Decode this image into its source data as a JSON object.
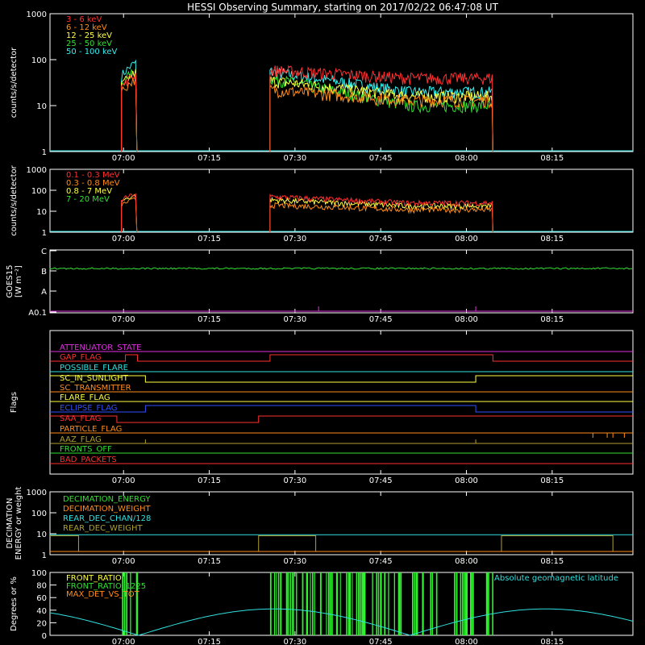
{
  "chart_data": {
    "type": "line",
    "title": "HESSI Observing Summary, starting on 2017/02/22 06:47:08 UT",
    "x_ticks": [
      "07:00",
      "07:15",
      "07:30",
      "07:45",
      "08:00",
      "08:15"
    ],
    "panels": [
      {
        "id": "lightcurve",
        "ylabel": "counts/s/detector",
        "scale": "log",
        "ylim": [
          1,
          1000
        ],
        "yticks": [
          "1",
          "10",
          "100",
          "1000"
        ],
        "series": [
          {
            "name": "3 - 6 keV",
            "color": "#ff3030",
            "pre": 50,
            "start": 60,
            "end": 40
          },
          {
            "name": "6 - 12 keV",
            "color": "#ff8c1a",
            "pre": 40,
            "start": 22,
            "end": 13
          },
          {
            "name": "12 - 25 keV",
            "color": "#ffff40",
            "pre": 55,
            "start": 35,
            "end": 16
          },
          {
            "name": "25 - 50 keV",
            "color": "#30e030",
            "pre": 60,
            "start": 40,
            "end": 10
          },
          {
            "name": "50 - 100 keV",
            "color": "#30f0f0",
            "pre": 90,
            "start": 55,
            "end": 20
          }
        ]
      },
      {
        "id": "gamma",
        "ylabel": "counts/s/detector",
        "scale": "log",
        "ylim": [
          1,
          1000
        ],
        "yticks": [
          "1",
          "10",
          "100",
          "1000"
        ],
        "series": [
          {
            "name": "0.1 - 0.3 MeV",
            "color": "#ff3030",
            "pre": 70,
            "start": 50,
            "end": 25
          },
          {
            "name": "0.3 - 0.8 MeV",
            "color": "#ff8c1a",
            "pre": 40,
            "start": 20,
            "end": 12
          },
          {
            "name": "0.8 - 7 MeV",
            "color": "#ffff40",
            "pre": 60,
            "start": 35,
            "end": 18
          },
          {
            "name": "7 - 20 MeV",
            "color": "#30e030",
            "pre": 1,
            "start": 1,
            "end": 1
          }
        ]
      },
      {
        "id": "goes",
        "ylabel_lines": [
          "GOES15",
          "[W m⁻²]"
        ],
        "yticks": [
          "A0.1",
          "A",
          "B",
          "C"
        ]
      },
      {
        "id": "flags",
        "ylabel": "Flags",
        "flags": [
          {
            "name": "ATTENUATOR_STATE",
            "color": "#e030e0"
          },
          {
            "name": "GAP_FLAG",
            "color": "#ff3030"
          },
          {
            "name": "POSSIBLE_FLARE",
            "color": "#30e0e0"
          },
          {
            "name": "SC_IN_SUNLIGHT",
            "color": "#ffff40"
          },
          {
            "name": "SC_TRANSMITTER",
            "color": "#ff8c1a"
          },
          {
            "name": "FLARE_FLAG",
            "color": "#ffff40"
          },
          {
            "name": "ECLIPSE_FLAG",
            "color": "#3050ff"
          },
          {
            "name": "SAA_FLAG",
            "color": "#ff3030"
          },
          {
            "name": "PARTICLE_FLAG",
            "color": "#ff8c1a"
          },
          {
            "name": "AAZ_FLAG",
            "color": "#b0a030"
          },
          {
            "name": "FRONTS_OFF",
            "color": "#30e030"
          },
          {
            "name": "BAD_PACKETS",
            "color": "#ff3030"
          }
        ]
      },
      {
        "id": "decimation",
        "ylabel_lines": [
          "DECIMATION",
          "ENERGY or weight"
        ],
        "scale": "log",
        "yticks": [
          "1",
          "10",
          "100",
          "1000"
        ],
        "series": [
          {
            "name": "DECIMATION_ENERGY",
            "color": "#30e030"
          },
          {
            "name": "DECIMATION_WEIGHT",
            "color": "#ff8c1a"
          },
          {
            "name": "REAR_DEC_CHAN/128",
            "color": "#30e0e0"
          },
          {
            "name": "REAR_DEC_WEIGHT",
            "color": "#b0a030"
          }
        ]
      },
      {
        "id": "ratio",
        "ylabel": "Degrees or %",
        "ylim": [
          0,
          100
        ],
        "yticks": [
          "0",
          "20",
          "40",
          "60",
          "80",
          "100"
        ],
        "series": [
          {
            "name": "FRONT_RATIO",
            "color": "#ffff40"
          },
          {
            "name": "FRONT_RATIO_1225",
            "color": "#30e030"
          },
          {
            "name": "MAX_DET_VS_TOT",
            "color": "#ff8c1a"
          }
        ],
        "annotation": "Absolute geomagnetic latitude"
      }
    ]
  }
}
